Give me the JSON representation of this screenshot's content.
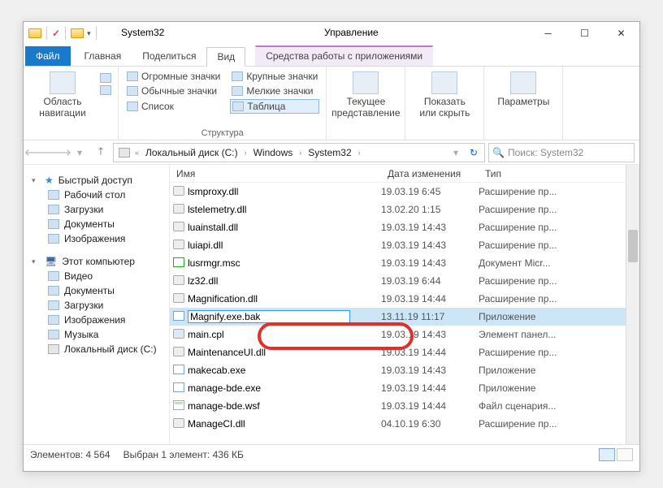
{
  "titlebar": {
    "title": "System32",
    "contextual_tab": "Управление"
  },
  "tabs": {
    "file": "Файл",
    "home": "Главная",
    "share": "Поделиться",
    "view": "Вид",
    "tools": "Средства работы с приложениями"
  },
  "ribbon": {
    "nav_panel": "Область навигации",
    "group_panels": "",
    "icons": {
      "xl": "Огромные значки",
      "lg": "Крупные значки",
      "md": "Обычные значки",
      "sm": "Мелкие значки",
      "list": "Список",
      "table": "Таблица"
    },
    "group_layout": "Структура",
    "current_view": "Текущее представление",
    "show_hide": "Показать или скрыть",
    "options": "Параметры"
  },
  "breadcrumb": {
    "drive": "Локальный диск (C:)",
    "p1": "Windows",
    "p2": "System32"
  },
  "search": {
    "placeholder": "Поиск: System32"
  },
  "nav": {
    "quick_access": "Быстрый доступ",
    "desktop": "Рабочий стол",
    "downloads": "Загрузки",
    "documents": "Документы",
    "pictures": "Изображения",
    "this_pc": "Этот компьютер",
    "videos": "Видео",
    "documents2": "Документы",
    "downloads2": "Загрузки",
    "pictures2": "Изображения",
    "music": "Музыка",
    "drive": "Локальный диск (C:)"
  },
  "columns": {
    "name": "Имя",
    "date": "Дата изменения",
    "type": "Тип"
  },
  "files": [
    {
      "name": "lsmproxy.dll",
      "date": "19.03.19 6:45",
      "type": "Расширение пр..."
    },
    {
      "name": "lstelemetry.dll",
      "date": "13.02.20 1:15",
      "type": "Расширение пр..."
    },
    {
      "name": "luainstall.dll",
      "date": "19.03.19 14:43",
      "type": "Расширение пр..."
    },
    {
      "name": "luiapi.dll",
      "date": "19.03.19 14:43",
      "type": "Расширение пр..."
    },
    {
      "name": "lusrmgr.msc",
      "date": "19.03.19 14:43",
      "type": "Документ Micr..."
    },
    {
      "name": "lz32.dll",
      "date": "19.03.19 6:44",
      "type": "Расширение пр..."
    },
    {
      "name": "Magnification.dll",
      "date": "19.03.19 14:44",
      "type": "Расширение пр..."
    },
    {
      "name": "Magnify.exe.bak",
      "date": "13.11.19 11:17",
      "type": "Приложение",
      "selected": true,
      "editing": true
    },
    {
      "name": "main.cpl",
      "date": "19.03.19 14:43",
      "type": "Элемент панел..."
    },
    {
      "name": "MaintenanceUI.dll",
      "date": "19.03.19 14:44",
      "type": "Расширение пр..."
    },
    {
      "name": "makecab.exe",
      "date": "19.03.19 14:43",
      "type": "Приложение"
    },
    {
      "name": "manage-bde.exe",
      "date": "19.03.19 14:44",
      "type": "Приложение"
    },
    {
      "name": "manage-bde.wsf",
      "date": "19.03.19 14:44",
      "type": "Файл сценария..."
    },
    {
      "name": "ManageCI.dll",
      "date": "04.10.19 6:30",
      "type": "Расширение пр..."
    }
  ],
  "status": {
    "items": "Элементов: 4 564",
    "selected": "Выбран 1 элемент: 436 КБ"
  }
}
